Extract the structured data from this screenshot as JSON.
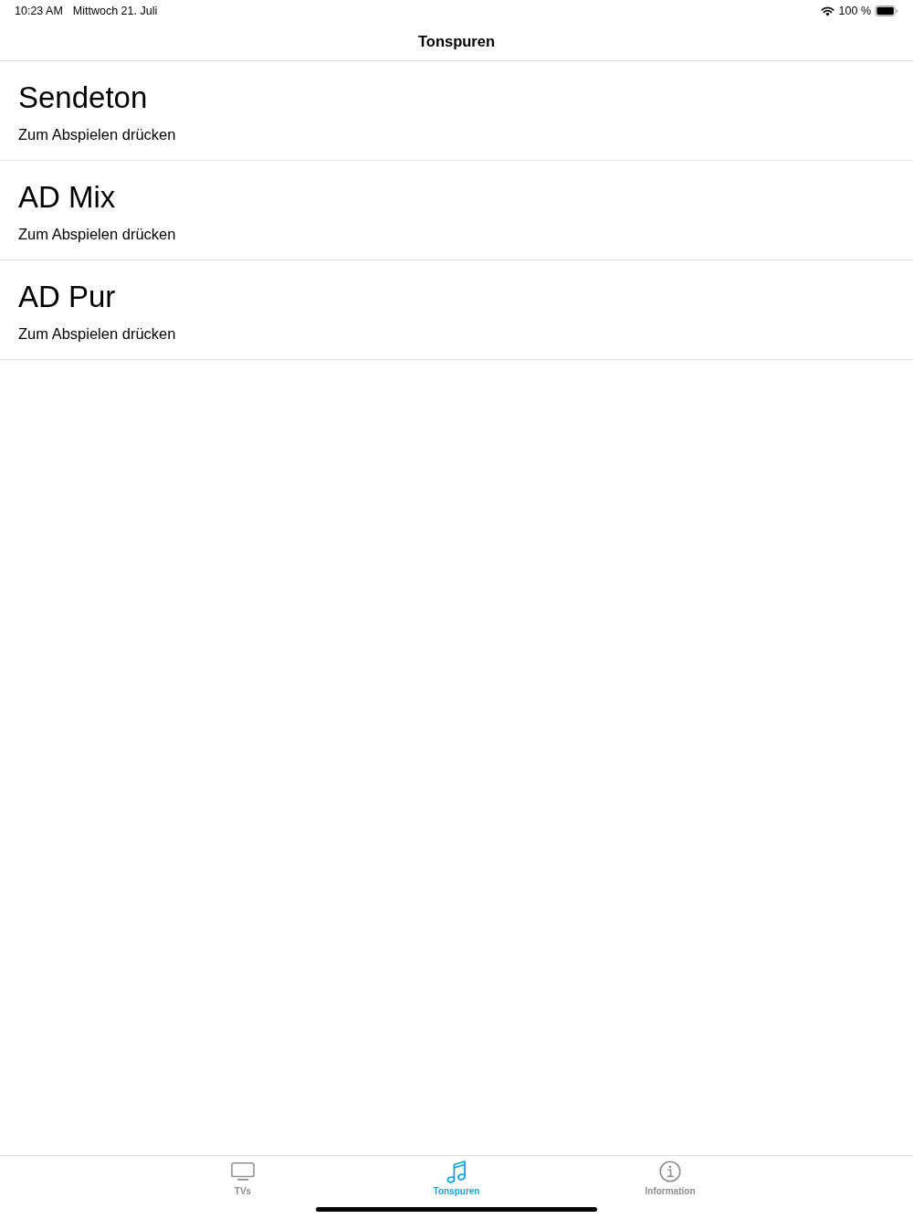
{
  "status_bar": {
    "time": "10:23 AM",
    "date": "Mittwoch 21. Juli",
    "battery": "100 %"
  },
  "nav_bar": {
    "title": "Tonspuren"
  },
  "tracks": [
    {
      "title": "Sendeton",
      "subtitle": "Zum Abspielen drücken"
    },
    {
      "title": "AD Mix",
      "subtitle": "Zum Abspielen drücken"
    },
    {
      "title": "AD Pur",
      "subtitle": "Zum Abspielen drücken"
    }
  ],
  "tab_bar": [
    {
      "label": "TVs",
      "selected": false
    },
    {
      "label": "Tonspuren",
      "selected": true
    },
    {
      "label": "Information",
      "selected": false
    }
  ]
}
